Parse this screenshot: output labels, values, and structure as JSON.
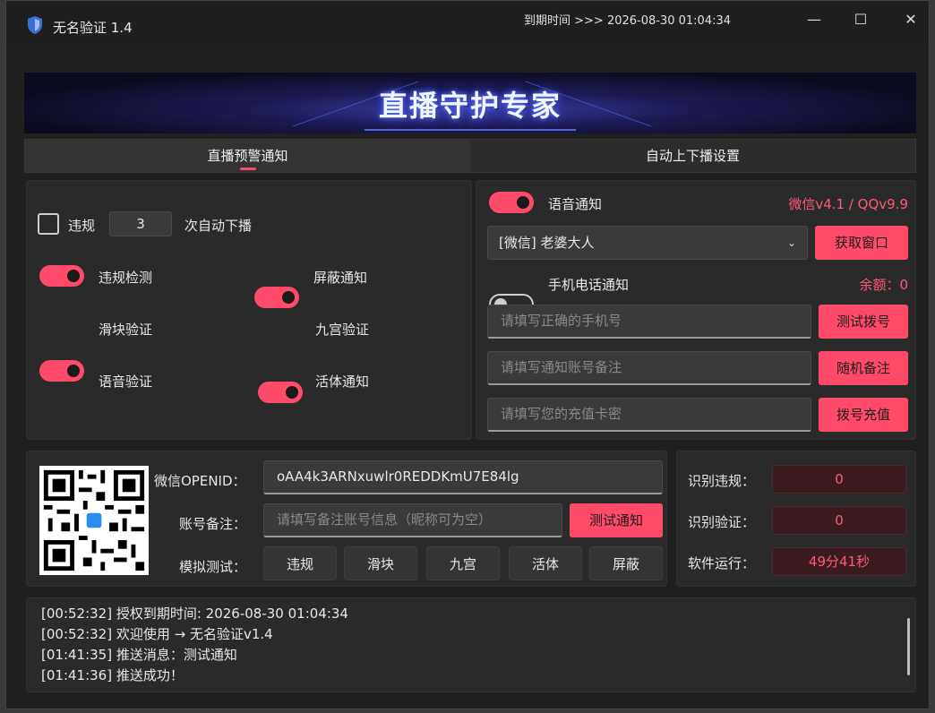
{
  "window": {
    "title": "无名验证 1.4",
    "expiry": "到期时间 >>> 2026-08-30 01:04:34",
    "controls": {
      "minimize": "—",
      "maximize": "☐",
      "close": "✕"
    }
  },
  "banner": {
    "text": "直播守护专家"
  },
  "tabs": [
    {
      "label": "直播预警通知",
      "active": true
    },
    {
      "label": "自动上下播设置",
      "active": false
    }
  ],
  "left_panel": {
    "violation_checkbox_label": "违规",
    "violation_count": "3",
    "auto_off_label": "次自动下播",
    "toggles": [
      {
        "label": "违规检测",
        "on": true
      },
      {
        "label": "屏蔽通知",
        "on": true
      },
      {
        "label": "滑块验证",
        "on": true
      },
      {
        "label": "九宫验证",
        "on": true
      },
      {
        "label": "语音验证",
        "on": true
      },
      {
        "label": "活体通知",
        "on": true
      }
    ]
  },
  "right_panel": {
    "voice_notify_label": "语音通知",
    "version_info": "微信v4.1 / QQv9.9",
    "window_select": "[微信] 老婆大人",
    "get_window_button": "获取窗口",
    "phone_notify_label": "手机电话通知",
    "balance": "余额：0",
    "phone_placeholder": "请填写正确的手机号",
    "test_dial_button": "测试拨号",
    "remark_placeholder": "请填写通知账号备注",
    "random_remark_button": "随机备注",
    "card_placeholder": "请填写您的充值卡密",
    "recharge_button": "拨号充值"
  },
  "bottom_panel": {
    "openid_label": "微信OPENID：",
    "openid_value": "oAA4k3ARNxuwlr0REDDKmU7E84lg",
    "remark_label": "账号备注：",
    "remark_placeholder": "请填写备注账号信息（昵称可为空）",
    "test_notify_button": "测试通知",
    "sim_label": "模拟测试：",
    "sim_buttons": [
      "违规",
      "滑块",
      "九宫",
      "活体",
      "屏蔽"
    ]
  },
  "stats": {
    "items": [
      {
        "label": "识别违规：",
        "value": "0"
      },
      {
        "label": "识别验证：",
        "value": "0"
      },
      {
        "label": "软件运行：",
        "value": "49分41秒"
      }
    ]
  },
  "log": [
    "[00:52:32] 授权到期时间: 2026-08-30 01:04:34",
    "[00:52:32] 欢迎使用 → 无名验证v1.4",
    "[01:41:35] 推送消息：测试通知",
    "[01:41:36] 推送成功！"
  ],
  "colors": {
    "accent": "#ff4a6a",
    "background": "#202020",
    "panel": "#2a2a2a"
  }
}
